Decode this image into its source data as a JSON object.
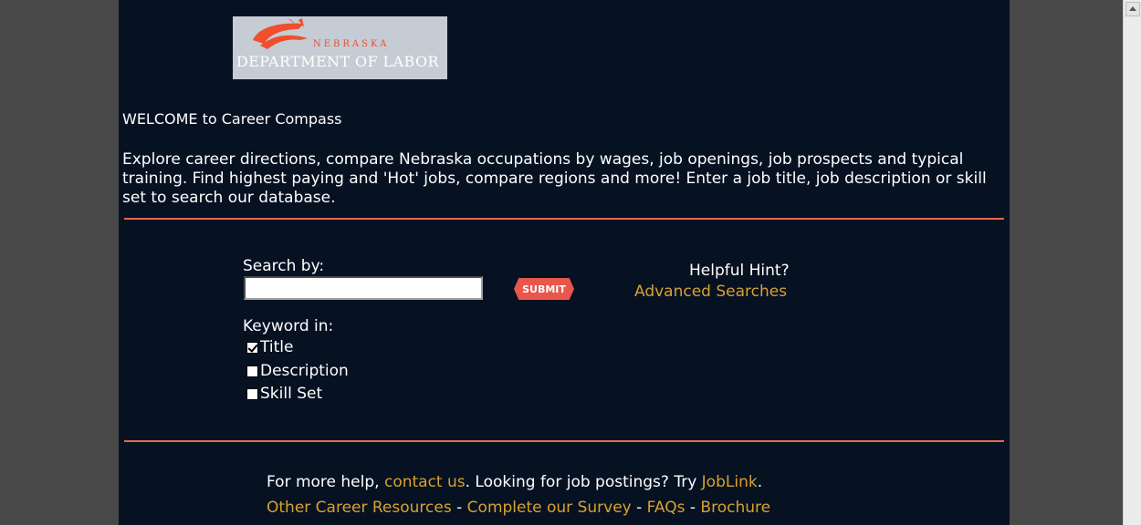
{
  "logo": {
    "state_text": "NEBRASKA",
    "dept_text": "DEPARTMENT OF LABOR"
  },
  "welcome": "WELCOME to Career Compass",
  "intro": "Explore career directions, compare Nebraska occupations by wages, job openings, job prospects and typical training. Find highest paying and 'Hot' jobs, compare regions and more! Enter a job title, job description or skill set to search our database.",
  "search": {
    "label": "Search by:",
    "value": "",
    "submit_label": "SUBMIT"
  },
  "hint": {
    "label": "Helpful Hint?",
    "link": "Advanced Searches"
  },
  "keyword": {
    "label": "Keyword in:",
    "options": [
      {
        "label": "Title",
        "checked": true
      },
      {
        "label": "Description",
        "checked": false
      },
      {
        "label": "Skill Set",
        "checked": false
      }
    ]
  },
  "footer": {
    "help_prefix": "For more help, ",
    "contact_link": "contact us",
    "help_middle": ". Looking for job postings? Try ",
    "joblink": "JobLink",
    "help_suffix": ".",
    "links": [
      "Other Career Resources",
      "Complete our Survey",
      "FAQs",
      "Brochure"
    ],
    "separator": " - "
  },
  "colors": {
    "page_bg": "#061122",
    "link": "#d8a22d",
    "rule": "#e26a55",
    "submit_bg": "#e8564c"
  }
}
